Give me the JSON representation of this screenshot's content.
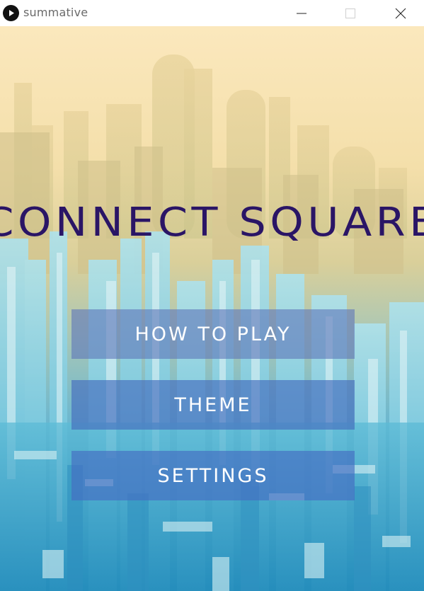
{
  "window": {
    "title": "summative",
    "icon": "play-icon",
    "controls": [
      "minimize-icon",
      "maximize-icon",
      "close-icon"
    ]
  },
  "game": {
    "title": "CONNECT SQUARE",
    "title_color": "#2a1566",
    "menu": [
      {
        "label": "HOW TO PLAY"
      },
      {
        "label": "THEME"
      },
      {
        "label": "SETTINGS"
      }
    ],
    "button_color": "#466ebe"
  }
}
